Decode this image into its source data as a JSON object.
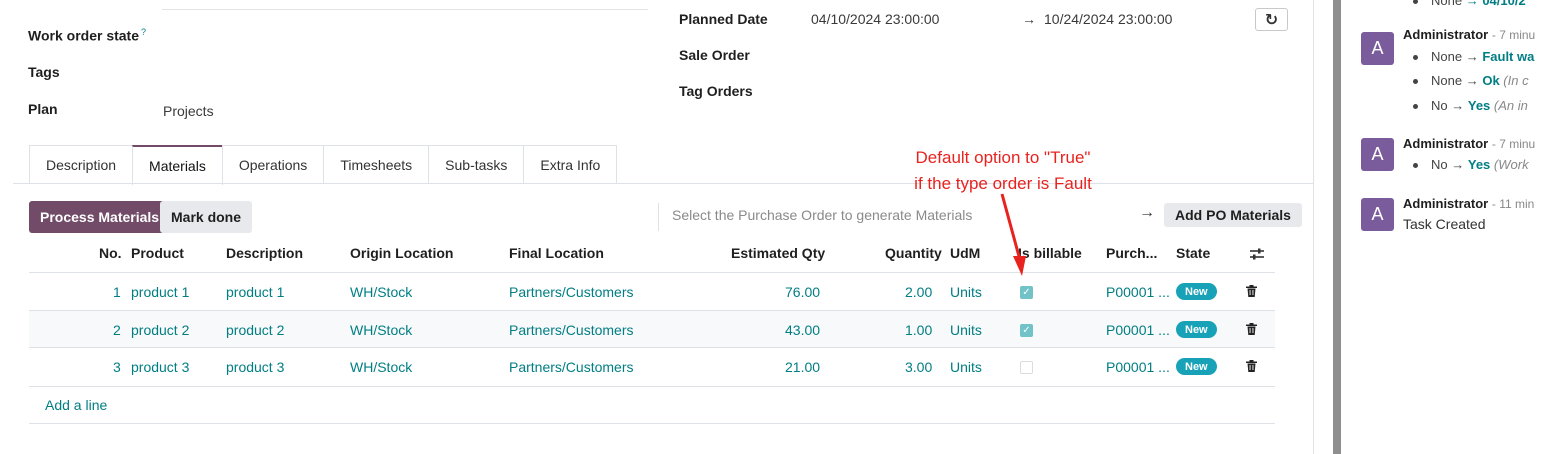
{
  "form": {
    "work_order_state_label": "Work order state",
    "help_mark": "?",
    "tags_label": "Tags",
    "plan_label": "Plan",
    "plan_value": "Projects",
    "planned_date_label": "Planned Date",
    "planned_date_start": "04/10/2024 23:00:00",
    "planned_date_arrow": "→",
    "planned_date_end": "10/24/2024 23:00:00",
    "refresh_icon": "↻",
    "sale_order_label": "Sale Order",
    "tag_orders_label": "Tag Orders"
  },
  "tabs": [
    {
      "label": "Description"
    },
    {
      "label": "Materials"
    },
    {
      "label": "Operations"
    },
    {
      "label": "Timesheets"
    },
    {
      "label": "Sub-tasks"
    },
    {
      "label": "Extra Info"
    }
  ],
  "active_tab": "Materials",
  "toolbar": {
    "process_label": "Process Materials",
    "mark_done_label": "Mark done",
    "po_placeholder": "Select the Purchase Order to generate Materials",
    "arrow": "→",
    "add_po_label": "Add PO Materials"
  },
  "table": {
    "headers": {
      "no": "No.",
      "product": "Product",
      "description": "Description",
      "origin": "Origin Location",
      "final": "Final Location",
      "est_qty": "Estimated Qty",
      "quantity": "Quantity",
      "udm": "UdM",
      "billable": "Is billable",
      "purchase": "Purch...",
      "state": "State"
    },
    "rows": [
      {
        "no": "1",
        "product": "product 1",
        "description": "product 1",
        "origin": "WH/Stock",
        "final": "Partners/Customers",
        "est_qty": "76.00",
        "quantity": "2.00",
        "udm": "Units",
        "billable": true,
        "purchase": "P00001 ...",
        "state": "New"
      },
      {
        "no": "2",
        "product": "product 2",
        "description": "product 2",
        "origin": "WH/Stock",
        "final": "Partners/Customers",
        "est_qty": "43.00",
        "quantity": "1.00",
        "udm": "Units",
        "billable": true,
        "purchase": "P00001 ...",
        "state": "New"
      },
      {
        "no": "3",
        "product": "product 3",
        "description": "product 3",
        "origin": "WH/Stock",
        "final": "Partners/Customers",
        "est_qty": "21.00",
        "quantity": "3.00",
        "udm": "Units",
        "billable": false,
        "purchase": "P00001 ...",
        "state": "New"
      }
    ],
    "add_line": "Add a line"
  },
  "annotation": {
    "line1": "Default option to \"True\"",
    "line2": "if the type order is Fault",
    "color": "#e8231f"
  },
  "chatter": {
    "top_partial": "None",
    "top_partial_arrow": "→ 04/10/2",
    "messages": [
      {
        "avatar": "A",
        "author": "Administrator",
        "time": "- 7 minu",
        "changes": [
          {
            "old": "None",
            "arrow": "→",
            "new": "Fault wa",
            "note": ""
          },
          {
            "old": "None",
            "arrow": "→",
            "new": "Ok",
            "note": "(In c"
          },
          {
            "old": "No",
            "arrow": "→",
            "new": "Yes",
            "note": "(An in"
          }
        ]
      },
      {
        "avatar": "A",
        "author": "Administrator",
        "time": "- 7 minu",
        "changes": [
          {
            "old": "No",
            "arrow": "→",
            "new": "Yes",
            "note": "(Work"
          }
        ]
      },
      {
        "avatar": "A",
        "author": "Administrator",
        "time": "- 11 min",
        "body": "Task Created"
      }
    ]
  },
  "colors": {
    "primary": "#714b67",
    "link": "#017e84",
    "badge": "#17a2b8",
    "avatar": "#7a5b9c"
  }
}
